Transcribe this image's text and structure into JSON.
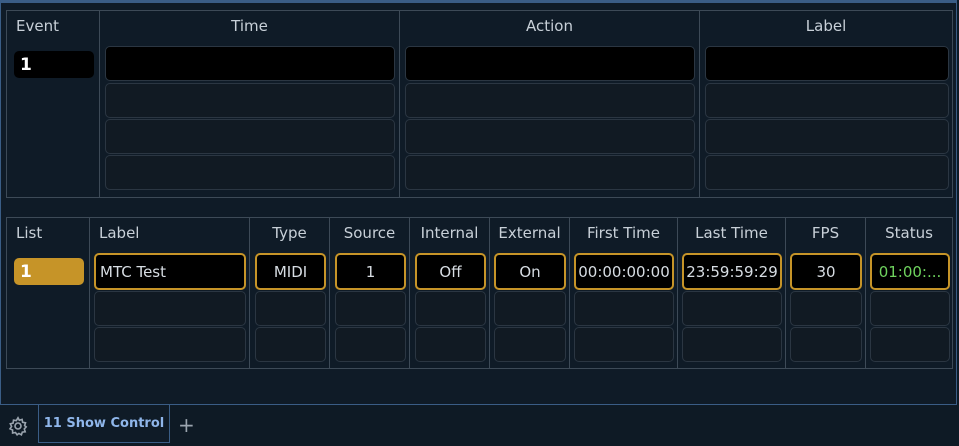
{
  "event_panel": {
    "headers": {
      "event": "Event",
      "time": "Time",
      "action": "Action",
      "label": "Label"
    },
    "event_number": "1"
  },
  "list_panel": {
    "headers": {
      "list": "List",
      "label": "Label",
      "type": "Type",
      "source": "Source",
      "internal": "Internal",
      "external": "External",
      "first_time": "First Time",
      "last_time": "Last Time",
      "fps": "FPS",
      "status": "Status"
    },
    "list_number": "1",
    "row": {
      "label": "MTC Test",
      "type": "MIDI",
      "source": "1",
      "internal": "Off",
      "external": "On",
      "first_time": "00:00:00:00",
      "last_time": "23:59:59:29",
      "fps": "30",
      "status": "01:00:..."
    }
  },
  "tabbar": {
    "settings_icon": "gear-icon",
    "tab_label": "11 Show Control",
    "add_icon": "plus-icon",
    "add_label": "+"
  },
  "colors": {
    "accent_gold": "#c69428",
    "tab_text": "#8fb6ea",
    "status_green": "#6fd35e"
  }
}
